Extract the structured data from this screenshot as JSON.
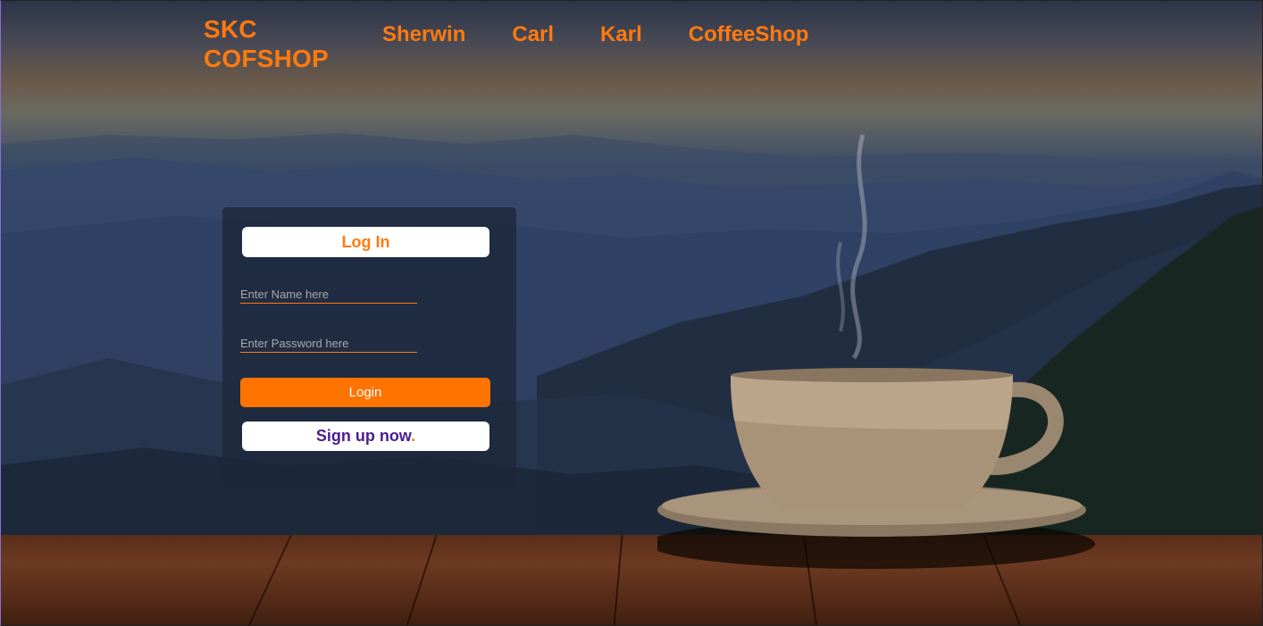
{
  "header": {
    "brand_line1": "SKC",
    "brand_line2": "COFSHOP",
    "nav": [
      {
        "label": "Sherwin"
      },
      {
        "label": "Carl"
      },
      {
        "label": "Karl"
      },
      {
        "label": "CoffeeShop"
      }
    ]
  },
  "login": {
    "title": "Log In",
    "name_placeholder": "Enter Name here",
    "password_placeholder": "Enter Password here",
    "login_button": "Login",
    "signup_text": "Sign up now",
    "signup_dot": "."
  },
  "colors": {
    "accent": "#ff7a0f",
    "signup_text": "#4b1e8f",
    "card_bg": "#1c2638"
  }
}
